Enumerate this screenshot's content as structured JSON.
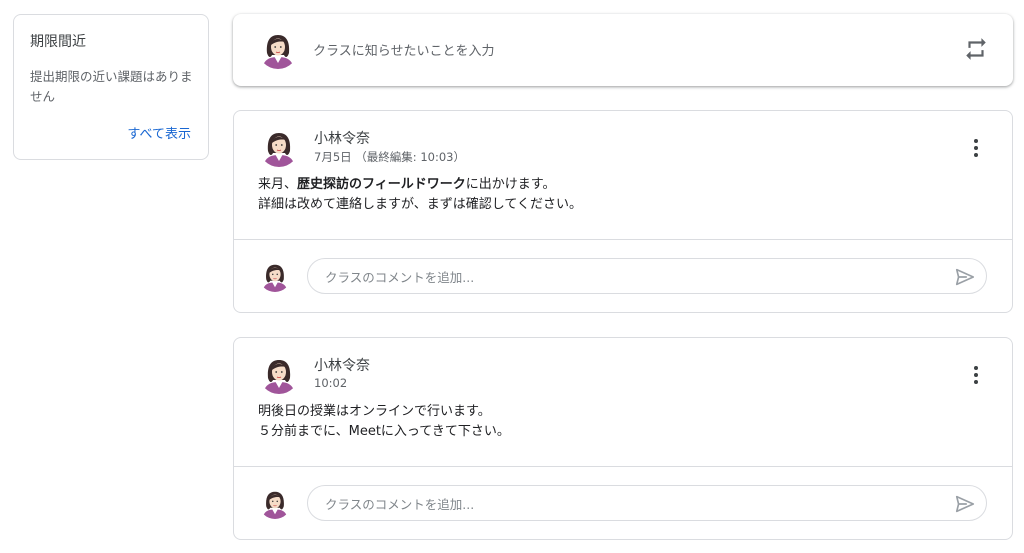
{
  "upcoming": {
    "title": "期限間近",
    "body": "提出期限の近い課題はありません",
    "view_all": "すべて表示"
  },
  "announce": {
    "placeholder": "クラスに知らせたいことを入力"
  },
  "posts": [
    {
      "author": "小林令奈",
      "time": "7月5日 （最終編集: 10:03）",
      "line1_pre": "来月、",
      "line1_bold": "歴史探訪のフィールドワーク",
      "line1_post": "に出かけます。",
      "line2": "詳細は改めて連絡しますが、まずは確認してください。",
      "comment_placeholder": "クラスのコメントを追加..."
    },
    {
      "author": "小林令奈",
      "time": "10:02",
      "line1": "明後日の授業はオンラインで行います。",
      "line2": "５分前までに、Meetに入ってきて下さい。",
      "comment_placeholder": "クラスのコメントを追加..."
    }
  ],
  "colors": {
    "link": "#1967d2",
    "border": "#dadce0",
    "text": "#3c4043",
    "muted": "#5f6368"
  },
  "icons": {
    "repost": "repost-icon",
    "menu": "more-vert-icon",
    "send": "send-icon",
    "avatar": "user-avatar"
  }
}
